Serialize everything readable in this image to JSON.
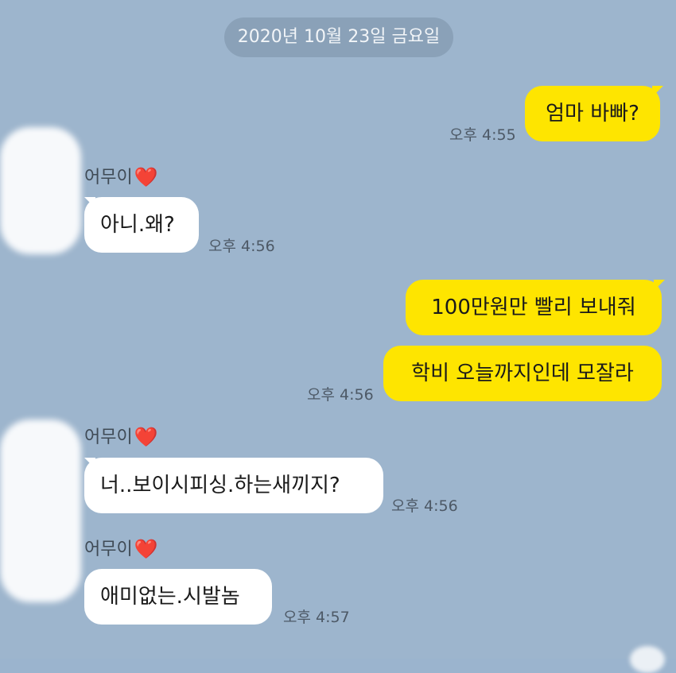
{
  "date_divider": "2020년 10월 23일 금요일",
  "messages": [
    {
      "sender": "me",
      "text": "엄마 바빠?",
      "time": "오후 4:55"
    },
    {
      "sender": "어무이",
      "text": "아니.왜?",
      "time": "오후 4:56"
    },
    {
      "sender": "me",
      "text": "100만원만 빨리 보내줘",
      "time": ""
    },
    {
      "sender": "me",
      "text": "학비 오늘까지인데 모잘라",
      "time": "오후 4:56"
    },
    {
      "sender": "어무이",
      "text": "너..보이시피싱.하는새끼지?",
      "time": "오후 4:56"
    },
    {
      "sender": "어무이",
      "text": "애미없는.시발놈",
      "time": "오후 4:57"
    }
  ],
  "contact": {
    "name": "어무이",
    "emoji": "❤️"
  },
  "colors": {
    "background": "#9db5cd",
    "outgoing_bubble": "#fee500",
    "incoming_bubble": "#ffffff",
    "heart": "#e0243a"
  }
}
